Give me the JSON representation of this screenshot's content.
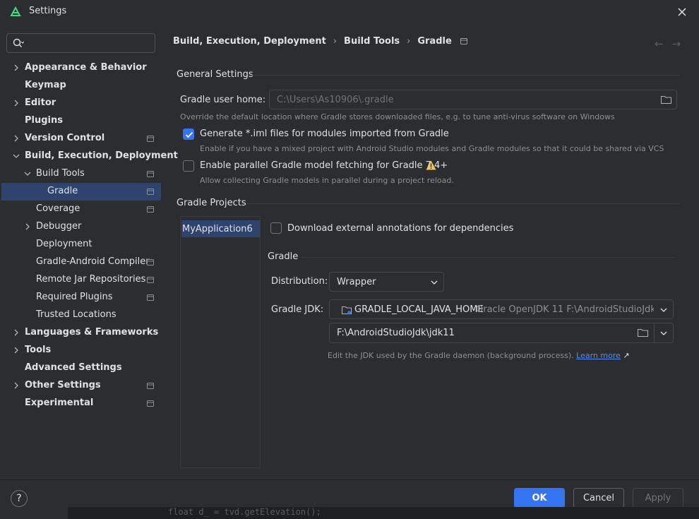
{
  "window": {
    "title": "Settings"
  },
  "search": {
    "placeholder": ""
  },
  "sidebar": {
    "items": [
      {
        "label": "Appearance & Behavior",
        "bold": true,
        "indent": 0,
        "chevron": "right",
        "proj": false
      },
      {
        "label": "Keymap",
        "bold": true,
        "indent": 0,
        "chevron": "none",
        "proj": false
      },
      {
        "label": "Editor",
        "bold": true,
        "indent": 0,
        "chevron": "right",
        "proj": false
      },
      {
        "label": "Plugins",
        "bold": true,
        "indent": 0,
        "chevron": "none",
        "proj": false
      },
      {
        "label": "Version Control",
        "bold": true,
        "indent": 0,
        "chevron": "right",
        "proj": true
      },
      {
        "label": "Build, Execution, Deployment",
        "bold": true,
        "indent": 0,
        "chevron": "down",
        "proj": false
      },
      {
        "label": "Build Tools",
        "bold": false,
        "indent": 1,
        "chevron": "down",
        "proj": true
      },
      {
        "label": "Gradle",
        "bold": false,
        "indent": 2,
        "chevron": "none",
        "proj": true,
        "selected": true
      },
      {
        "label": "Coverage",
        "bold": false,
        "indent": 1,
        "chevron": "none",
        "proj": true
      },
      {
        "label": "Debugger",
        "bold": false,
        "indent": 1,
        "chevron": "right",
        "proj": false
      },
      {
        "label": "Deployment",
        "bold": false,
        "indent": 1,
        "chevron": "none",
        "proj": false
      },
      {
        "label": "Gradle-Android Compiler",
        "bold": false,
        "indent": 1,
        "chevron": "none",
        "proj": true
      },
      {
        "label": "Remote Jar Repositories",
        "bold": false,
        "indent": 1,
        "chevron": "none",
        "proj": true
      },
      {
        "label": "Required Plugins",
        "bold": false,
        "indent": 1,
        "chevron": "none",
        "proj": true
      },
      {
        "label": "Trusted Locations",
        "bold": false,
        "indent": 1,
        "chevron": "none",
        "proj": false
      },
      {
        "label": "Languages & Frameworks",
        "bold": true,
        "indent": 0,
        "chevron": "right",
        "proj": false
      },
      {
        "label": "Tools",
        "bold": true,
        "indent": 0,
        "chevron": "right",
        "proj": false
      },
      {
        "label": "Advanced Settings",
        "bold": true,
        "indent": 0,
        "chevron": "none",
        "proj": false
      },
      {
        "label": "Other Settings",
        "bold": true,
        "indent": 0,
        "chevron": "right",
        "proj": true
      },
      {
        "label": "Experimental",
        "bold": true,
        "indent": 0,
        "chevron": "none",
        "proj": true
      }
    ]
  },
  "breadcrumb": {
    "part1": "Build, Execution, Deployment",
    "sep": "›",
    "part2": "Build Tools",
    "part3": "Gradle"
  },
  "nav": {
    "back": "←",
    "forward": "→"
  },
  "general": {
    "title": "General Settings",
    "gradle_home_label": "Gradle user home:",
    "gradle_home_value": "C:\\Users\\As10906\\.gradle",
    "gradle_home_hint": "Override the default location where Gradle stores downloaded files, e.g. to tune anti-virus software on Windows",
    "iml_label": "Generate *.iml files for modules imported from Gradle",
    "iml_checked": true,
    "iml_hint": "Enable if you have a mixed project with Android Studio modules and Gradle modules so that it could be shared via VCS",
    "parallel_label": "Enable parallel Gradle model fetching for Gradle 7.4+",
    "parallel_checked": false,
    "parallel_hint": "Allow collecting Gradle models in parallel during a project reload."
  },
  "projects": {
    "title": "Gradle Projects",
    "items": [
      "MyApplication6"
    ],
    "download_annotations_label": "Download external annotations for dependencies",
    "download_annotations_checked": false,
    "gradle_title": "Gradle",
    "distribution_label": "Distribution:",
    "distribution_value": "Wrapper",
    "jdk_label": "Gradle JDK:",
    "jdk_value": "GRADLE_LOCAL_JAVA_HOME",
    "jdk_detail": "Oracle OpenJDK 11 F:\\AndroidStudioJdk\\jd",
    "jdk_path": "F:\\AndroidStudioJdk\\jdk11",
    "jdk_hint": "Edit the JDK used by the Gradle daemon (background process).",
    "learn_more": "Learn more",
    "learn_more_arrow": "↗"
  },
  "footer": {
    "help": "?",
    "ok": "OK",
    "cancel": "Cancel",
    "apply": "Apply"
  },
  "background_code": "float d_ = tvd.getElevation();",
  "colors": {
    "accent": "#3574f0",
    "selection": "#2e436e",
    "background": "#2b2d30",
    "warning": "#f2c55c"
  }
}
